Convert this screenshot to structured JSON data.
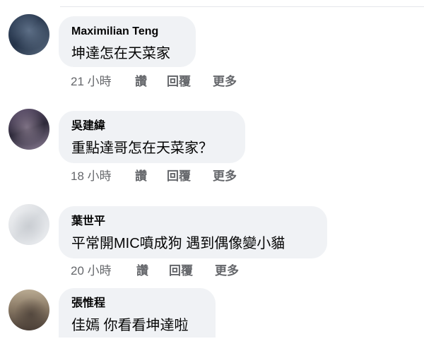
{
  "comments": [
    {
      "name": "Maximilian Teng",
      "text": "坤達怎在天菜家",
      "time": "21 小時",
      "actions": [
        "讚",
        "回覆",
        "更多"
      ]
    },
    {
      "name": "吳建緯",
      "text": "重點達哥怎在天菜家？",
      "time": "18 小時",
      "actions": [
        "讚",
        "回覆",
        "更多"
      ]
    },
    {
      "name": "葉世平",
      "text": "平常開MIC噴成狗 遇到偶像變小貓",
      "time": "20 小時",
      "actions": [
        "讚",
        "回覆",
        "更多"
      ]
    },
    {
      "name": "張惟程",
      "text": "佳嫣 你看看坤達啦",
      "time": "",
      "actions": []
    }
  ]
}
